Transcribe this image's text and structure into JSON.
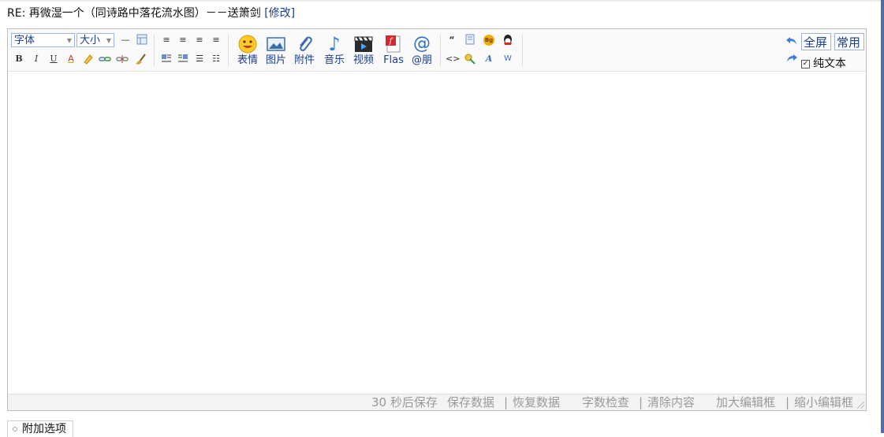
{
  "reply": {
    "title": "RE: 再微湿一个（同诗路中落花流水图）－－送箫剑",
    "edit_link": "[修改]"
  },
  "toolbar": {
    "font_select": "字体",
    "size_select": "大小",
    "emoticon_label": "表情",
    "image_label": "图片",
    "attachment_label": "附件",
    "music_label": "音乐",
    "video_label": "视频",
    "flash_label": "Flas",
    "mention_label": "@朋",
    "bold": "B",
    "italic": "I",
    "underline": "U",
    "font_color": "A",
    "quote": "“",
    "bg_icon": "Bg",
    "code": "<>",
    "w_icon": "W",
    "fullscreen_label": "全屏",
    "common_label": "常用",
    "plaintext_label": "纯文本",
    "plaintext_checked": true
  },
  "status_bar": {
    "autosave": "30 秒后保存",
    "save_data": "保存数据",
    "restore_data": "恢复数据",
    "word_count": "字数检查",
    "clear_content": "清除内容",
    "enlarge": "加大编辑框",
    "shrink": "缩小编辑框",
    "separator": "|"
  },
  "extra_options": {
    "label": "附加选项"
  },
  "colors": {
    "link": "#1a3d8f",
    "border": "#bdbdbd",
    "status_text": "#9a9a9a",
    "accent_bar": "#4a6fb0"
  }
}
